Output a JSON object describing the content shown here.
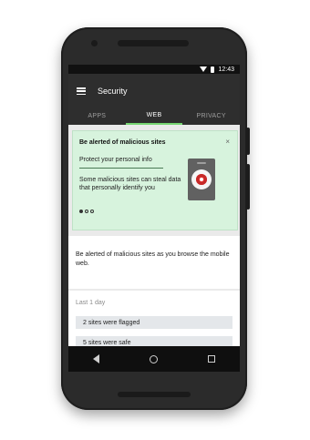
{
  "status_bar": {
    "time": "12:43"
  },
  "app_bar": {
    "title": "Security"
  },
  "tabs": [
    {
      "label": "APPS"
    },
    {
      "label": "WEB"
    },
    {
      "label": "PRIVACY"
    }
  ],
  "card": {
    "title": "Be alerted of malicious sites",
    "close_glyph": "×",
    "subtitle": "Protect your personal info",
    "body": "Some malicious sites can steal data that personally identify you",
    "page_indicator": {
      "current": 1,
      "total": 3
    }
  },
  "description": "Be alerted of malicious sites as you browse the mobile web.",
  "history": {
    "label": "Last 1 day",
    "rows": [
      {
        "text": "2 sites were flagged"
      },
      {
        "text": "5 sites were safe"
      }
    ]
  },
  "colors": {
    "accent_green": "#76d672",
    "card_bg": "#d7f3dd",
    "alert_red": "#e53935",
    "app_bar": "#2e2e2e"
  },
  "icons": {
    "menu": "hamburger-menu-icon",
    "close": "close-icon",
    "device": "phone-eye-icon",
    "back": "nav-back-icon",
    "home": "nav-home-icon",
    "recent": "nav-recent-icon",
    "wifi": "wifi-icon",
    "battery": "battery-icon"
  }
}
